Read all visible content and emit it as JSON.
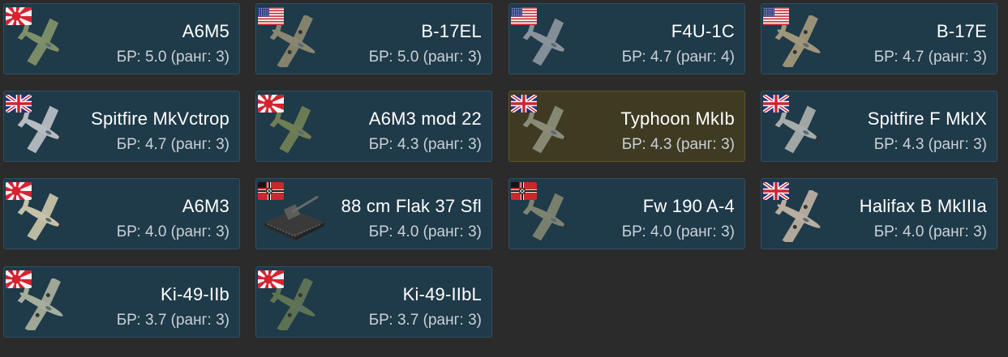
{
  "vehicles": [
    {
      "name": "A6M5",
      "br": "БР: 5.0 (ранг: 3)",
      "flag": "japan-flag",
      "kind": "fighter",
      "camo": "#7f8f6a",
      "highlighted": false
    },
    {
      "name": "B-17EL",
      "br": "БР: 5.0 (ранг: 3)",
      "flag": "usa-flag",
      "kind": "bomber",
      "camo": "#8a8670",
      "highlighted": false
    },
    {
      "name": "F4U-1C",
      "br": "БР: 4.7 (ранг: 4)",
      "flag": "usa-flag",
      "kind": "fighter",
      "camo": "#8a929b",
      "highlighted": false
    },
    {
      "name": "B-17E",
      "br": "БР: 4.7 (ранг: 3)",
      "flag": "usa-flag",
      "kind": "bomber",
      "camo": "#a0967a",
      "highlighted": false
    },
    {
      "name": "Spitfire MkVctrop",
      "br": "БР: 4.7 (ранг: 3)",
      "flag": "uk-flag",
      "kind": "fighter",
      "camo": "#b6bcc2",
      "highlighted": false
    },
    {
      "name": "A6M3 mod 22",
      "br": "БР: 4.3 (ранг: 3)",
      "flag": "japan-flag",
      "kind": "fighter",
      "camo": "#6f7e55",
      "highlighted": false
    },
    {
      "name": "Typhoon MkIb",
      "br": "БР: 4.3 (ранг: 3)",
      "flag": "uk-flag",
      "kind": "fighter",
      "camo": "#8a8c78",
      "highlighted": true
    },
    {
      "name": "Spitfire F MkIX",
      "br": "БР: 4.3 (ранг: 3)",
      "flag": "uk-flag",
      "kind": "fighter",
      "camo": "#a7acaa",
      "highlighted": false
    },
    {
      "name": "A6M3",
      "br": "БР: 4.0 (ранг: 3)",
      "flag": "japan-flag",
      "kind": "fighter",
      "camo": "#c6c1a8",
      "highlighted": false
    },
    {
      "name": "88 cm Flak 37 Sfl",
      "br": "БР: 4.0 (ранг: 3)",
      "flag": "germany-flag",
      "kind": "vehicle",
      "camo": "#4f4f4f",
      "highlighted": false
    },
    {
      "name": "Fw 190 A-4",
      "br": "БР: 4.0 (ранг: 3)",
      "flag": "germany-flag",
      "kind": "fighter",
      "camo": "#7e8370",
      "highlighted": false
    },
    {
      "name": "Halifax B MkIIIa",
      "br": "БР: 4.0 (ранг: 3)",
      "flag": "uk-flag",
      "kind": "bomber",
      "camo": "#b9aea0",
      "highlighted": false
    },
    {
      "name": "Ki-49-IIb",
      "br": "БР: 3.7 (ранг: 3)",
      "flag": "japan-flag",
      "kind": "bomber",
      "camo": "#a5ad9c",
      "highlighted": false
    },
    {
      "name": "Ki-49-IIbL",
      "br": "БР: 3.7 (ранг: 3)",
      "flag": "japan-flag",
      "kind": "bomber",
      "camo": "#5f7455",
      "highlighted": false
    }
  ]
}
